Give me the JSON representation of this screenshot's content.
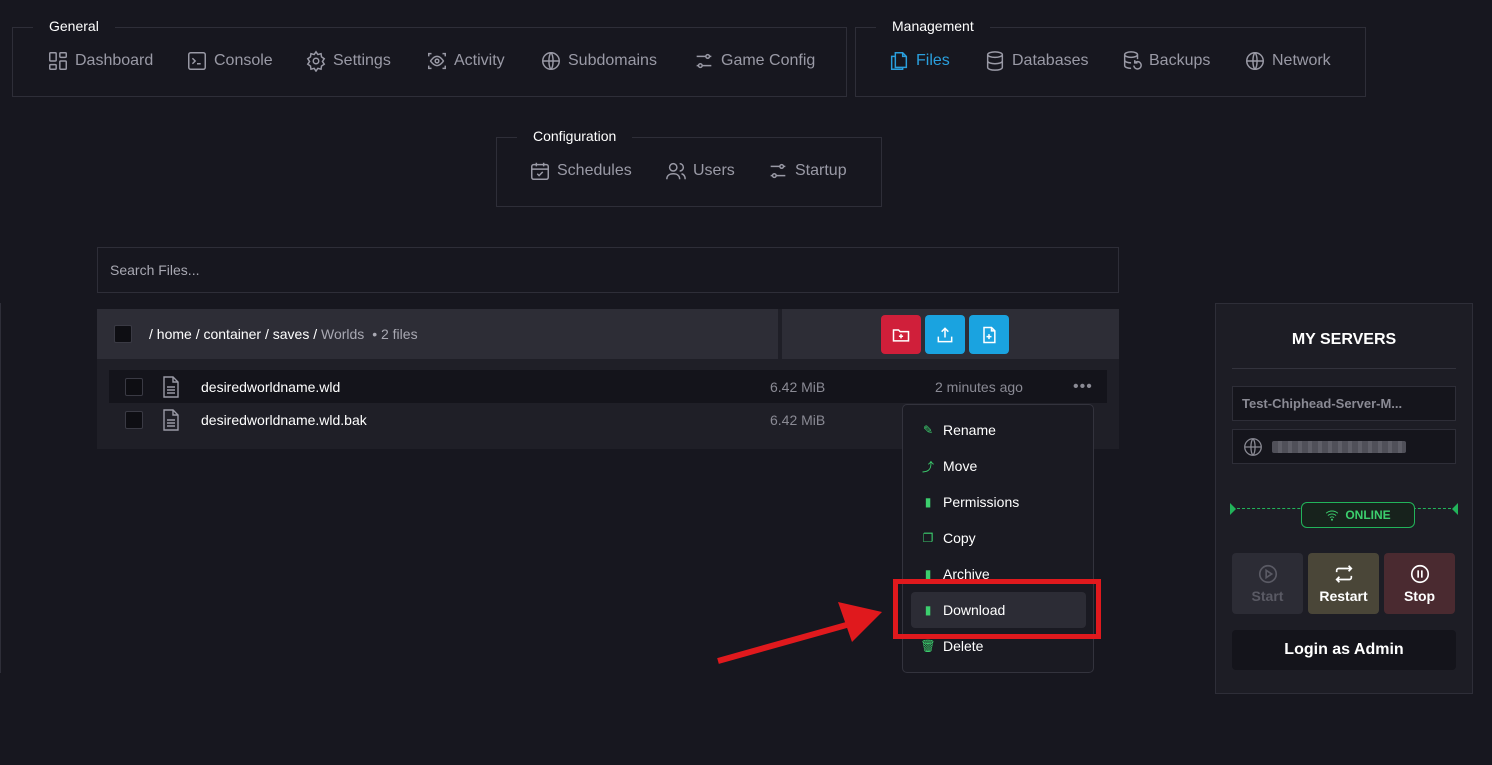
{
  "nav": {
    "general": {
      "legend": "General",
      "items": [
        {
          "label": "Dashboard",
          "icon": "dashboard-icon"
        },
        {
          "label": "Console",
          "icon": "console-icon"
        },
        {
          "label": "Settings",
          "icon": "gear-icon"
        },
        {
          "label": "Activity",
          "icon": "activity-icon"
        },
        {
          "label": "Subdomains",
          "icon": "globe-icon"
        },
        {
          "label": "Game Config",
          "icon": "sliders-icon"
        }
      ]
    },
    "management": {
      "legend": "Management",
      "items": [
        {
          "label": "Files",
          "icon": "files-icon",
          "active": true
        },
        {
          "label": "Databases",
          "icon": "database-icon"
        },
        {
          "label": "Backups",
          "icon": "backup-icon"
        },
        {
          "label": "Network",
          "icon": "globe-icon"
        }
      ]
    },
    "configuration": {
      "legend": "Configuration",
      "items": [
        {
          "label": "Schedules",
          "icon": "calendar-icon"
        },
        {
          "label": "Users",
          "icon": "users-icon"
        },
        {
          "label": "Startup",
          "icon": "sliders-icon"
        }
      ]
    }
  },
  "search": {
    "placeholder": "Search Files..."
  },
  "path": {
    "sep": "/",
    "segments": [
      "home",
      "container",
      "saves"
    ],
    "current": "Worlds",
    "count": "• 2 files"
  },
  "actions": [
    {
      "name": "new-folder",
      "color": "#d01f3a"
    },
    {
      "name": "upload",
      "color": "#1aa3e0"
    },
    {
      "name": "new-file",
      "color": "#1aa3e0"
    }
  ],
  "files": [
    {
      "name": "desiredworldname.wld",
      "size": "6.42 MiB",
      "modified": "2 minutes ago",
      "more": "•••"
    },
    {
      "name": "desiredworldname.wld.bak",
      "size": "6.42 MiB",
      "modified": "",
      "more": ""
    }
  ],
  "context_menu": {
    "items": [
      "Rename",
      "Move",
      "Permissions",
      "Copy",
      "Archive",
      "Download",
      "Delete"
    ],
    "highlighted": "Download"
  },
  "servers": {
    "title": "MY SERVERS",
    "name": "Test-Chiphead-Server-M...",
    "status": "ONLINE",
    "buttons": {
      "start": "Start",
      "restart": "Restart",
      "stop": "Stop"
    },
    "login": "Login as Admin"
  },
  "colors": {
    "accent": "#2a9fdd",
    "online": "#3ccf6e",
    "annotation": "#e0191d"
  }
}
